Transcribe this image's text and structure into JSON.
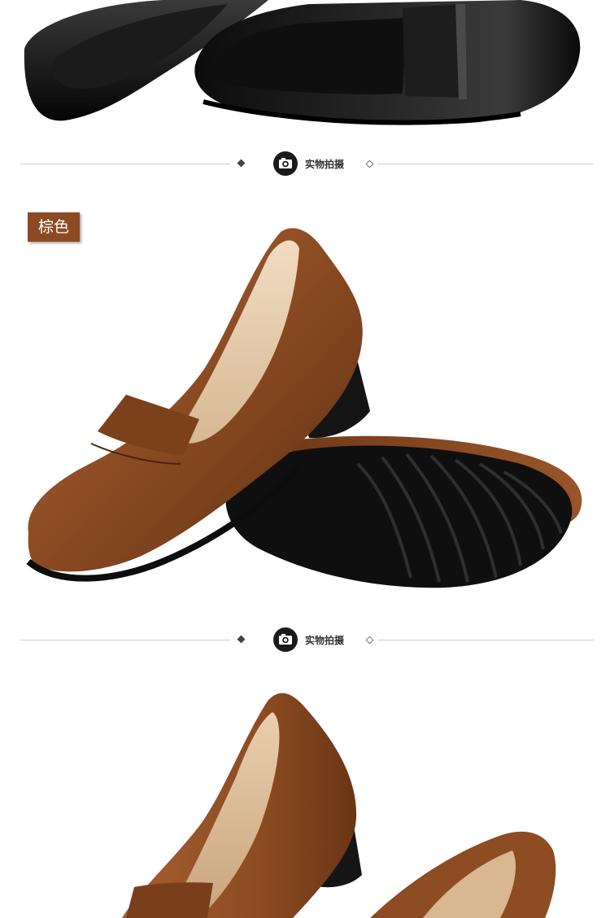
{
  "section_label": "实物拍摄",
  "color_tag": "棕色",
  "icons": {
    "camera": "camera-icon",
    "diamond": "diamond-icon"
  },
  "colors": {
    "black_leather": "#111111",
    "brown_leather": "#8a4a22",
    "tag_background": "#8b4a24",
    "divider_line": "#cfcfcf"
  }
}
